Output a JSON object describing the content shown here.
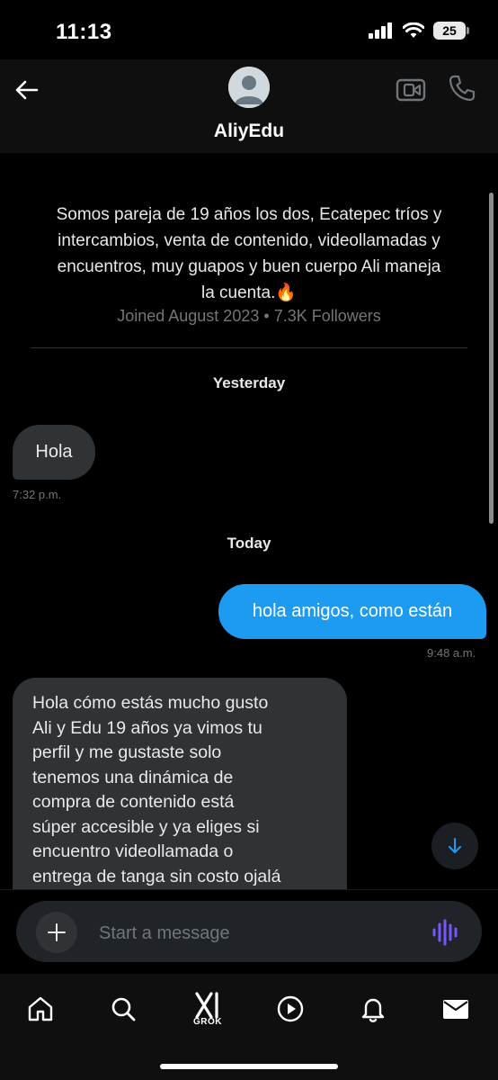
{
  "status_bar": {
    "time": "11:13",
    "battery": "25"
  },
  "header": {
    "name": "AliyEdu"
  },
  "profile": {
    "bio_lines": [
      "Somos pareja de 19 años los dos, Ecatepec tríos y",
      "intercambios, venta de contenido, videollamadas y",
      "encuentros, muy guapos y buen cuerpo Ali maneja",
      "la cuenta.🔥"
    ],
    "joined": "Joined August 2023",
    "separator": "•",
    "followers": "7.3K Followers"
  },
  "conversation": {
    "day_yesterday": "Yesterday",
    "msg1": {
      "text": "Hola",
      "time": "7:32 p.m."
    },
    "day_today": "Today",
    "msg2": {
      "text": "hola amigos, como están",
      "time": "9:48 a.m."
    },
    "msg3": {
      "lines": [
        "Hola cómo estás mucho gusto",
        "Ali y Edu 19 años ya vimos tu",
        "perfil y me gustaste solo",
        "tenemos una dinámica de",
        "compra de contenido está",
        "súper accesible y ya eliges si",
        "encuentro videollamada o",
        "entrega de tanga sin costo ojalá"
      ]
    }
  },
  "composer": {
    "placeholder": "Start a message"
  },
  "nav": {
    "grok_label": "GROK"
  },
  "colors": {
    "accent": "#1d9bf0",
    "bubble_in": "#2f3336",
    "voice": "#7856ff"
  },
  "icons": [
    "back-arrow-icon",
    "avatar-icon",
    "video-camera-icon",
    "phone-icon",
    "arrow-down-icon",
    "plus-icon",
    "voice-wave-icon",
    "home-icon",
    "search-icon",
    "grok-icon",
    "play-icon",
    "bell-icon",
    "mail-icon"
  ]
}
